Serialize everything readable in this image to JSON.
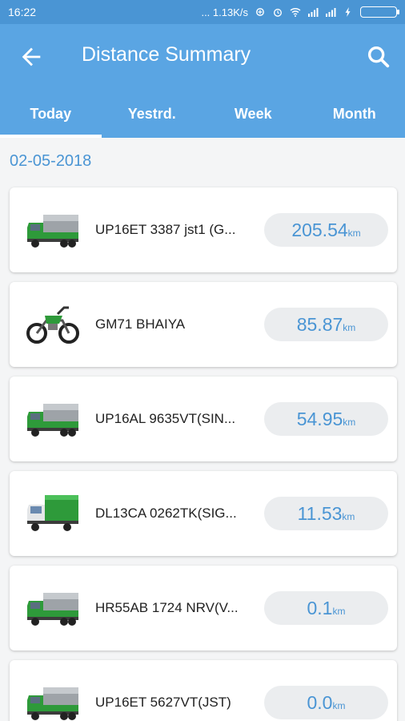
{
  "status_bar": {
    "time": "16:22",
    "net_speed": "... 1.13K/s"
  },
  "app_bar": {
    "title": "Distance Summary"
  },
  "tabs": [
    {
      "label": "Today",
      "active": true
    },
    {
      "label": "Yestrd.",
      "active": false
    },
    {
      "label": "Week",
      "active": false
    },
    {
      "label": "Month",
      "active": false
    }
  ],
  "date_label": "02-05-2018",
  "colors": {
    "app_bar": "#5aa5e3",
    "status_bar": "#4a95d4",
    "accent": "#4a95d4",
    "pill_bg": "#ebedef"
  },
  "vehicles": [
    {
      "name": "UP16ET 3387 jst1 (G...",
      "distance": "205.54",
      "unit": "km",
      "icon": "truck-icon"
    },
    {
      "name": "GM71 BHAIYA",
      "distance": "85.87",
      "unit": "km",
      "icon": "motorcycle-icon"
    },
    {
      "name": "UP16AL 9635VT(SIN...",
      "distance": "54.95",
      "unit": "km",
      "icon": "truck-icon"
    },
    {
      "name": "DL13CA 0262TK(SIG...",
      "distance": "11.53",
      "unit": "km",
      "icon": "pickup-truck-icon"
    },
    {
      "name": "HR55AB 1724 NRV(V...",
      "distance": "0.1",
      "unit": "km",
      "icon": "truck-icon"
    },
    {
      "name": "UP16ET 5627VT(JST)",
      "distance": "0.0",
      "unit": "km",
      "icon": "truck-icon"
    }
  ]
}
